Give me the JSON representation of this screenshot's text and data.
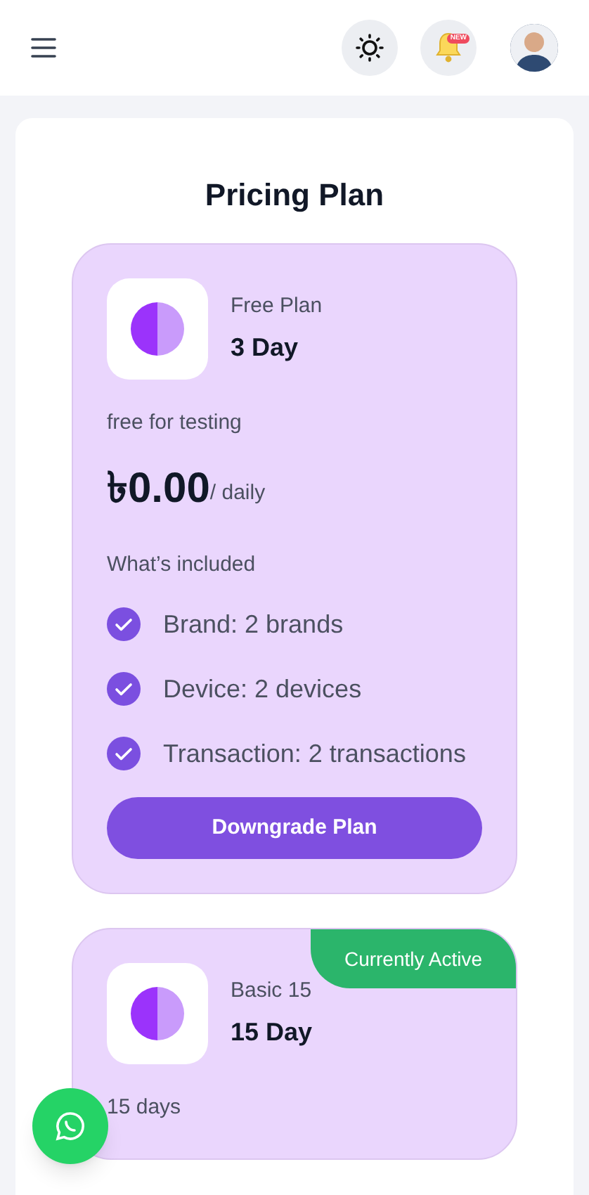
{
  "header": {
    "notification_badge": "NEW"
  },
  "title": "Pricing Plan",
  "plans": [
    {
      "name": "Free Plan",
      "duration": "3 Day",
      "description": "free for testing",
      "price": "৳0.00",
      "period": "/ daily",
      "included_heading": "What’s included",
      "features": [
        "Brand: 2 brands",
        "Device: 2 devices",
        "Transaction: 2 transactions"
      ],
      "button": "Downgrade Plan",
      "active": false
    },
    {
      "name": "Basic 15",
      "duration": "15 Day",
      "description": "15 days",
      "active": true,
      "status": "Currently Active"
    }
  ]
}
